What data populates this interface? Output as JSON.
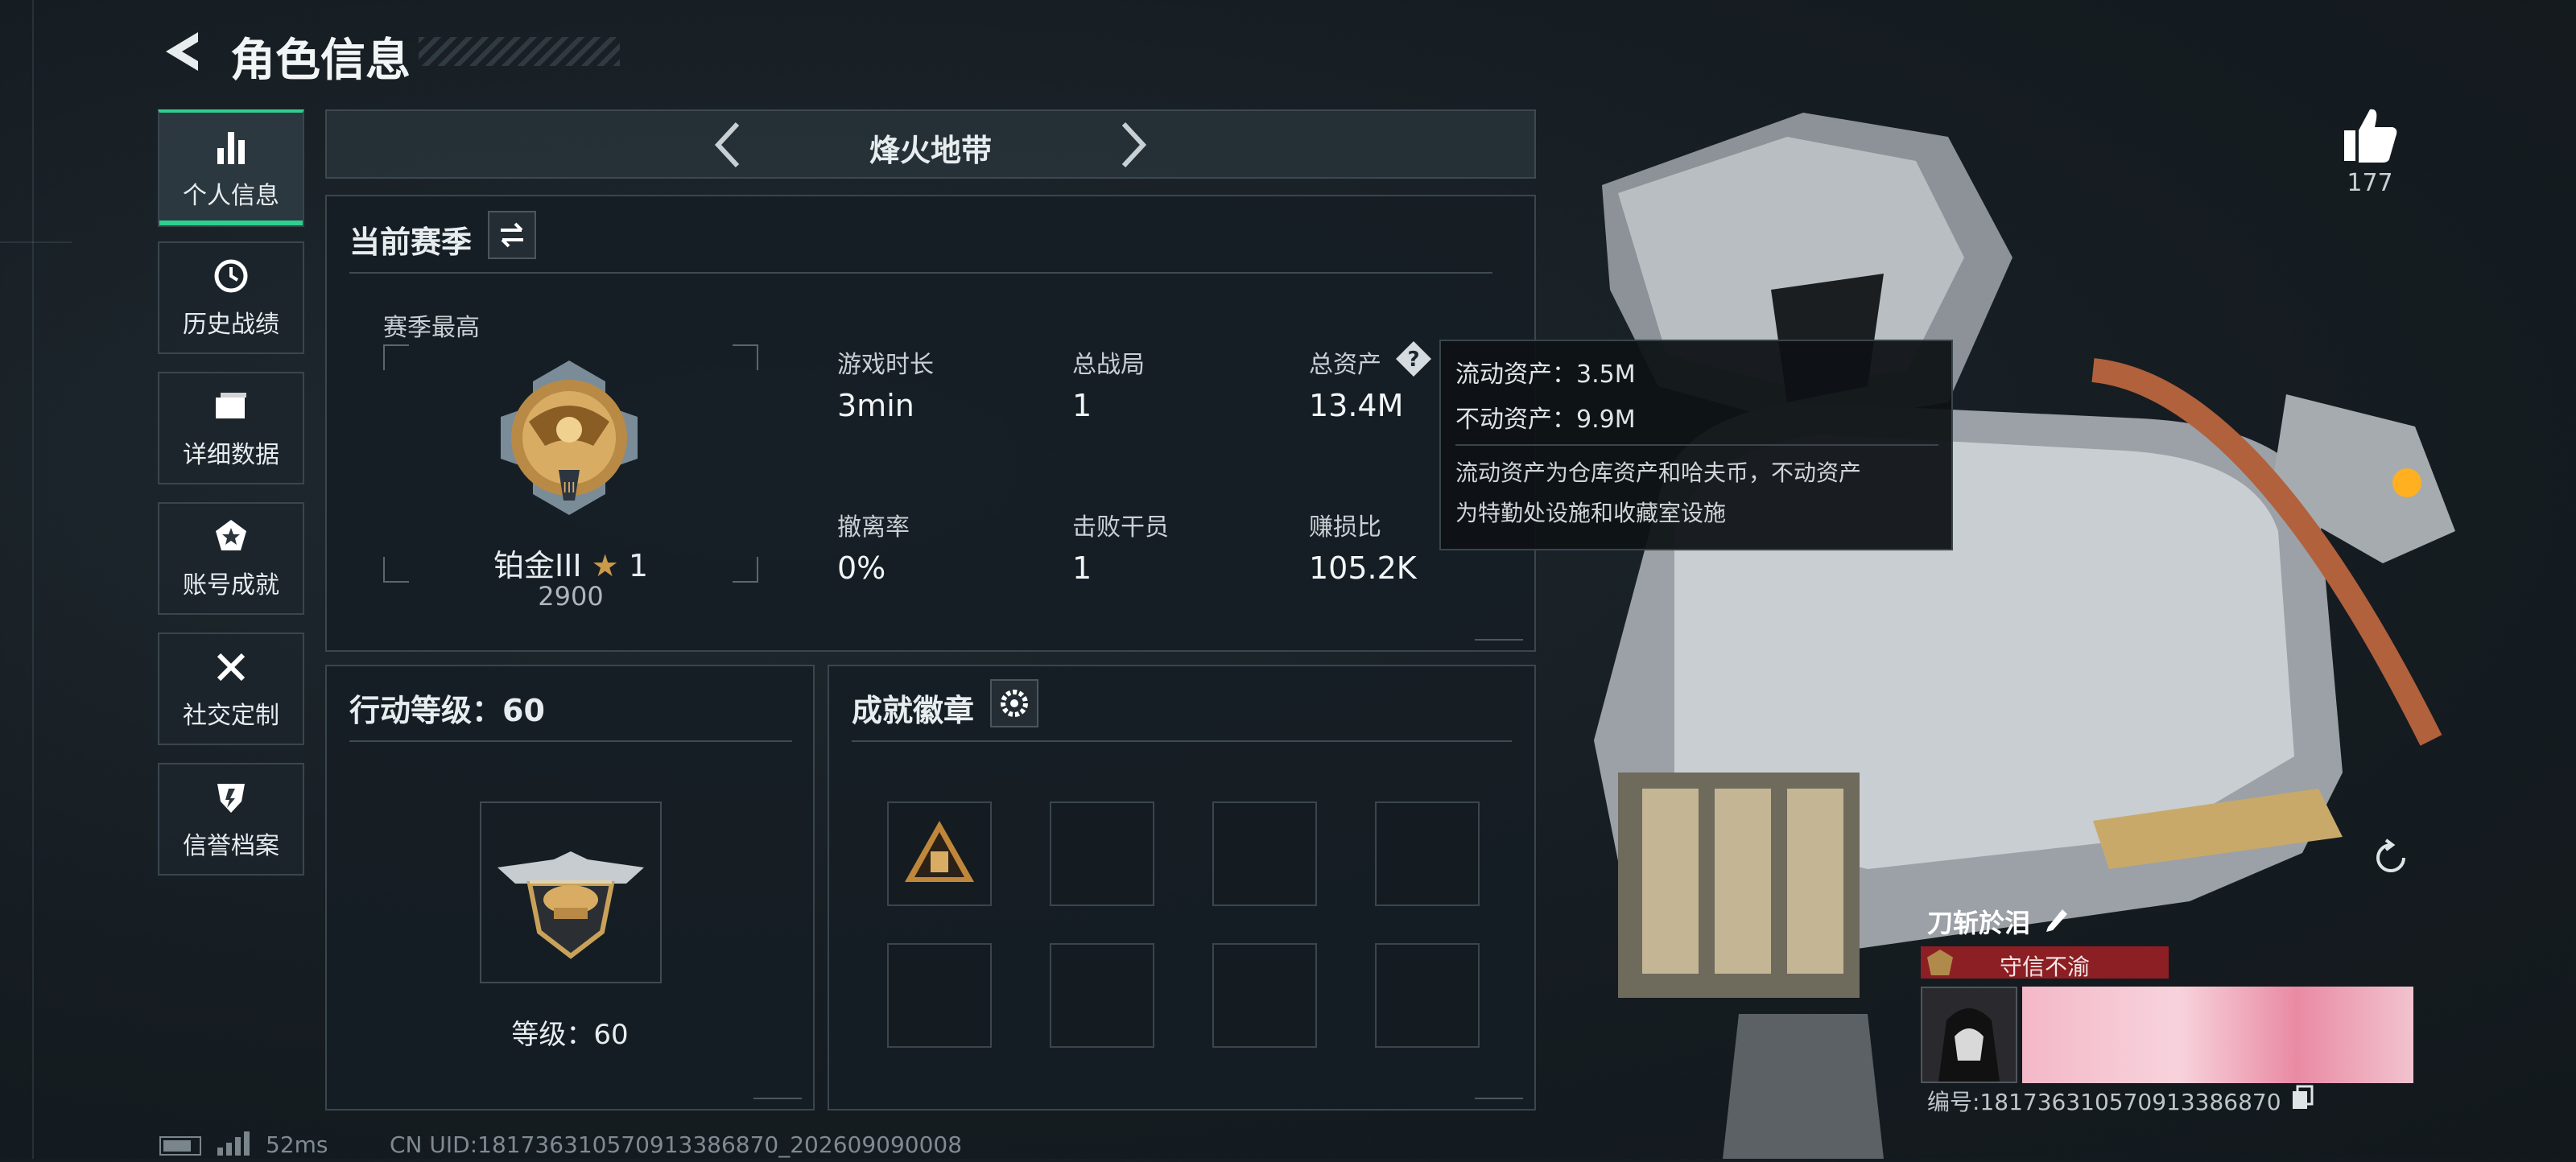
{
  "header": {
    "title": "角色信息"
  },
  "sidebar": {
    "items": [
      {
        "label": "个人信息"
      },
      {
        "label": "历史战绩"
      },
      {
        "label": "详细数据"
      },
      {
        "label": "账号成就"
      },
      {
        "label": "社交定制"
      },
      {
        "label": "信誉档案"
      }
    ]
  },
  "mode_switcher": {
    "title": "烽火地带"
  },
  "season": {
    "title": "当前赛季",
    "best_label": "赛季最高",
    "rank": "铂金III",
    "stars": "1",
    "score": "2900",
    "stats": [
      {
        "label": "游戏时长",
        "value": "3min"
      },
      {
        "label": "总战局",
        "value": "1"
      },
      {
        "label": "总资产",
        "value": "13.4M"
      },
      {
        "label": "撤离率",
        "value": "0%"
      },
      {
        "label": "击败干员",
        "value": "1"
      },
      {
        "label": "赚损比",
        "value": "105.2K"
      }
    ]
  },
  "tooltip": {
    "line1": "流动资产：3.5M",
    "line2": "不动资产：9.9M",
    "desc1": "流动资产为仓库资产和哈夫币，不动资产",
    "desc2": "为特勤处设施和收藏室设施"
  },
  "action_level": {
    "title": "行动等级：60",
    "level_text": "等级：60"
  },
  "achievements": {
    "title": "成就徽章"
  },
  "likes": {
    "count": "177"
  },
  "player": {
    "name": "刀斩於泪",
    "badge_title": "守信不渝",
    "id_text": "编号:1817363105709133868​70"
  },
  "footer": {
    "ping": "52ms",
    "uid": "CN UID:1817363105709133868​70_202609090008"
  },
  "colors": {
    "accent": "#2fd08f",
    "badge_red": "#8c1f24",
    "rank_gold": "#c99a4a"
  }
}
